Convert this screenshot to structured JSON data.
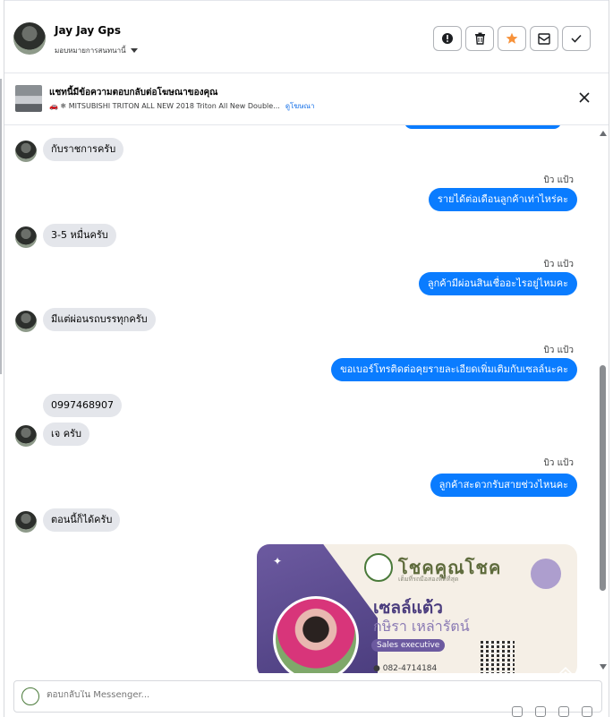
{
  "header": {
    "contact_name": "Jay Jay Gps",
    "assign_label": "มอบหมายการสนทนานี้"
  },
  "banner": {
    "title": "แชทนี้มีข้อความตอบกลับต่อโฆษณาของคุณ",
    "ad_text": "🚗 ❄ MITSUBISHI TRITON ALL NEW 2018 Triton All New Double...",
    "ad_link": "ดูโฆษณา"
  },
  "messages": [
    {
      "from": "customer",
      "text": "กับราชการครับ"
    },
    {
      "from": "page",
      "sender": "บิว แป้ว",
      "text": "รายได้ต่อเดือนลูกค้าเท่าไหร่คะ"
    },
    {
      "from": "customer",
      "text": "3-5 หมื่นครับ"
    },
    {
      "from": "page",
      "sender": "บิว แป้ว",
      "text": "ลูกค้ามีผ่อนสินเชื่ออะไรอยู่ไหมคะ"
    },
    {
      "from": "customer",
      "text": "มีแต่ผ่อนรถบรรทุกครับ"
    },
    {
      "from": "page",
      "sender": "บิว แป้ว",
      "text": "ขอเบอร์โทรติดต่อคุยรายละเอียดเพิ่มเติมกับเซลล์นะคะ"
    },
    {
      "from": "customer",
      "text": "0997468907"
    },
    {
      "from": "customer",
      "text": "เจ ครับ"
    },
    {
      "from": "page",
      "sender": "บิว แป้ว",
      "text": "ลูกค้าสะดวกรับสายช่วงไหนคะ"
    },
    {
      "from": "customer",
      "text": "ตอนนี้ก็ได้ครับ"
    }
  ],
  "card": {
    "brand": "โชคคูณโชค",
    "tagline": "เต็มที่รถมือสองที่ดีที่สุด",
    "name_nick": "เซลล์แต้ว",
    "name_full": "กษิรา เหล่ารัตน์",
    "role": "Sales executive",
    "phone": "082-4714184"
  },
  "composer": {
    "placeholder": "ตอบกลับใน Messenger..."
  },
  "colors": {
    "outgoing_bubble": "#0a7cff",
    "incoming_bubble": "#e4e6eb",
    "star_active": "#f7923a"
  },
  "icons": {
    "action_buttons": [
      "alert-icon",
      "trash-icon",
      "star-icon",
      "mail-icon",
      "check-icon"
    ]
  }
}
